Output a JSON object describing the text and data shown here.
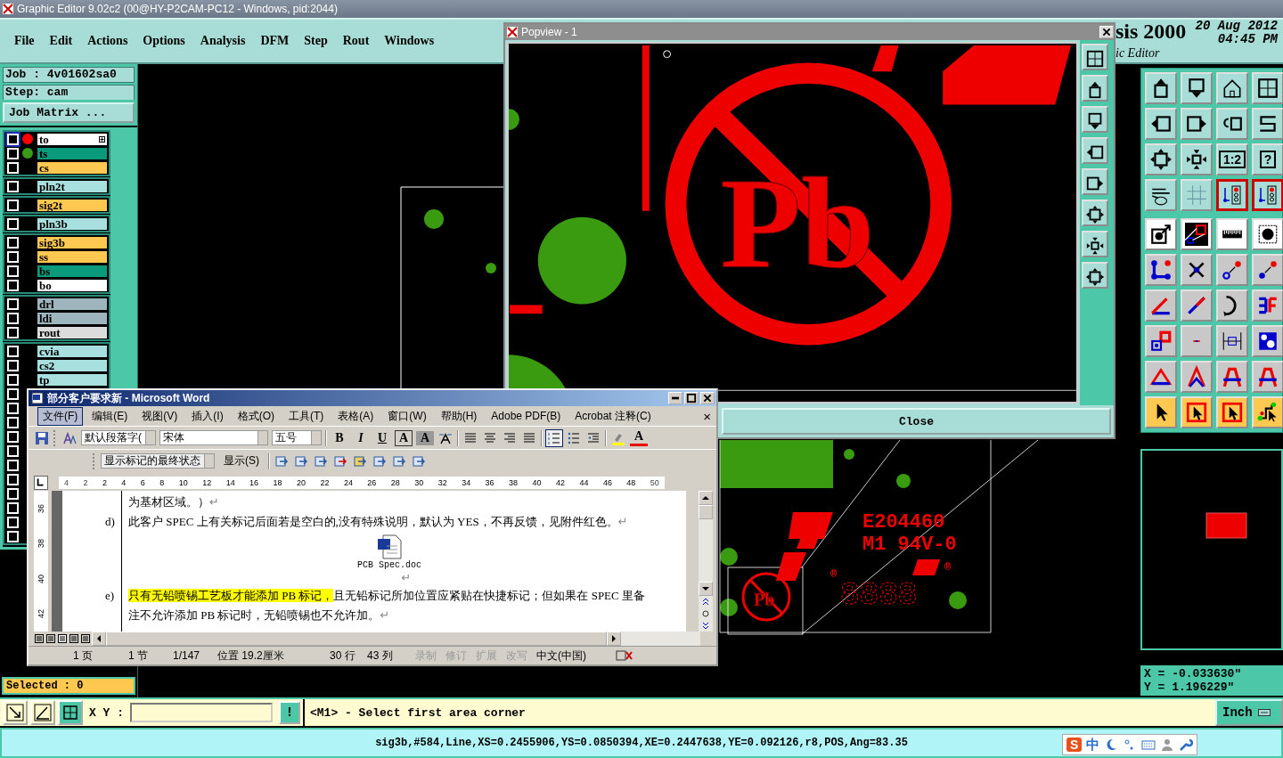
{
  "window": {
    "title": "Graphic Editor 9.02c2 (00@HY-P2CAM-PC12 - Windows, pid:2044)"
  },
  "menu": [
    {
      "label": "File"
    },
    {
      "label": "Edit"
    },
    {
      "label": "Actions"
    },
    {
      "label": "Options"
    },
    {
      "label": "Analysis"
    },
    {
      "label": "DFM"
    },
    {
      "label": "Step"
    },
    {
      "label": "Rout"
    },
    {
      "label": "Windows"
    }
  ],
  "header": {
    "product": "sis 2000",
    "date": "20 Aug 2012",
    "time": "04:45 PM",
    "subtitle": "ic Editor"
  },
  "job": {
    "job": "Job : 4v01602sa0",
    "step": "Step: cam",
    "matrix_button": "Job Matrix ..."
  },
  "layer_groups": [
    {
      "layers": [
        {
          "name": "to",
          "color": "#ffffff",
          "dot": {
            "color": "#ff0000"
          },
          "selected": true
        },
        {
          "name": "ts",
          "color": "#0a9a7c",
          "dot": {
            "color": "#3a9a1a"
          },
          "selected": false
        },
        {
          "name": "cs",
          "color": "#ffc850",
          "selected": false
        }
      ]
    },
    {
      "layers": [
        {
          "name": "pln2t",
          "color": "#a8e0e0",
          "selected": false
        }
      ]
    },
    {
      "layers": [
        {
          "name": "sig2t",
          "color": "#ffc850",
          "selected": false
        }
      ]
    },
    {
      "layers": [
        {
          "name": "pln3b",
          "color": "#a8e0e0",
          "selected": false
        }
      ]
    },
    {
      "layers": [
        {
          "name": "sig3b",
          "color": "#ffc850",
          "selected": false
        },
        {
          "name": "ss",
          "color": "#ffc850",
          "selected": false
        },
        {
          "name": "bs",
          "color": "#0a9a7c",
          "selected": false
        },
        {
          "name": "bo",
          "color": "#ffffff",
          "selected": false
        }
      ]
    },
    {
      "layers": [
        {
          "name": "drl",
          "color": "#9fb5bd",
          "selected": false
        },
        {
          "name": "ldi",
          "color": "#9fb5bd",
          "selected": false
        },
        {
          "name": "rout",
          "color": "#dcdcdc",
          "selected": false
        }
      ]
    },
    {
      "layers": [
        {
          "name": "cvia",
          "color": "#a8e0e0",
          "selected": false
        },
        {
          "name": "cs2",
          "color": "#a8e0e0",
          "selected": false
        },
        {
          "name": "tp",
          "color": "#a8e0e0",
          "selected": false
        },
        {
          "selected": false
        },
        {
          "selected": false
        },
        {
          "selected": false
        },
        {
          "selected": false
        },
        {
          "selected": false
        },
        {
          "selected": false
        },
        {
          "selected": false
        },
        {
          "selected": false
        },
        {
          "selected": false
        },
        {
          "selected": false
        },
        {
          "selected": false
        }
      ]
    }
  ],
  "selected_count": "Selected : 0",
  "canvas": {
    "labels": [
      "E204460",
      "M1 94V-0",
      "®",
      "®",
      "Pb",
      "8888"
    ]
  },
  "popview": {
    "title": "Popview - 1",
    "close_button": "Close",
    "labels": [
      "Pb"
    ]
  },
  "tools": [
    {
      "kind": "teal",
      "active": false
    },
    {
      "kind": "teal",
      "active": false
    },
    {
      "kind": "teal",
      "active": false
    },
    {
      "kind": "teal",
      "active": false
    },
    {
      "kind": "teal",
      "active": false
    },
    {
      "kind": "teal",
      "active": false
    },
    {
      "kind": "teal",
      "active": false
    },
    {
      "kind": "teal",
      "active": false
    },
    {
      "kind": "teal",
      "active": false
    },
    {
      "kind": "teal",
      "active": false
    },
    {
      "kind": "teal",
      "active": false,
      "label": "1:2"
    },
    {
      "kind": "teal",
      "active": false,
      "label": "?"
    },
    {
      "kind": "teal",
      "active": false
    },
    {
      "kind": "teal",
      "active": false
    },
    {
      "kind": "teal",
      "active": true
    },
    {
      "kind": "teal",
      "active": true
    },
    {
      "kind": "white",
      "active": false
    },
    {
      "kind": "white",
      "active": false
    },
    {
      "kind": "white",
      "active": false
    },
    {
      "kind": "white",
      "active": false
    },
    {
      "kind": "grey",
      "active": false
    },
    {
      "kind": "grey",
      "active": false
    },
    {
      "kind": "grey",
      "active": false
    },
    {
      "kind": "grey",
      "active": false
    },
    {
      "kind": "grey",
      "active": false
    },
    {
      "kind": "grey",
      "active": false
    },
    {
      "kind": "grey",
      "active": false
    },
    {
      "kind": "grey",
      "active": false
    },
    {
      "kind": "grey",
      "active": false
    },
    {
      "kind": "grey",
      "active": false
    },
    {
      "kind": "grey",
      "active": false
    },
    {
      "kind": "grey",
      "active": false
    },
    {
      "kind": "grey",
      "active": false
    },
    {
      "kind": "grey",
      "active": false
    },
    {
      "kind": "grey",
      "active": false
    },
    {
      "kind": "grey",
      "active": false
    },
    {
      "kind": "orange",
      "active": false
    },
    {
      "kind": "orange",
      "active": false
    },
    {
      "kind": "orange",
      "active": false
    },
    {
      "kind": "orange",
      "active": false
    }
  ],
  "coordinates": {
    "x": "X = -0.033630\"",
    "y": "Y = 1.196229\""
  },
  "command": {
    "xy_label": "X Y :",
    "bang_button": "!",
    "prompt": "<M1> - Select first area corner",
    "units": "Inch"
  },
  "status_bar": {
    "text": "sig3b,#584,Line,XS=0.2455906,YS=0.0850394,XE=0.2447638,YE=0.092126,r8,POS,Ang=83.35"
  },
  "ime": {
    "logo": "S",
    "mode": "中"
  },
  "word": {
    "title": "部分客户要求新 - Microsoft Word",
    "menu": [
      {
        "label": "文件(F)",
        "selected": true
      },
      {
        "label": "编辑(E)",
        "selected": false
      },
      {
        "label": "视图(V)",
        "selected": false
      },
      {
        "label": "插入(I)",
        "selected": false
      },
      {
        "label": "格式(O)",
        "selected": false
      },
      {
        "label": "工具(T)",
        "selected": false
      },
      {
        "label": "表格(A)",
        "selected": false
      },
      {
        "label": "窗口(W)",
        "selected": false
      },
      {
        "label": "帮助(H)",
        "selected": false
      },
      {
        "label": "Adobe PDF(B)",
        "selected": false
      },
      {
        "label": "Acrobat 注释(C)",
        "selected": false
      }
    ],
    "menu_close": "×",
    "format_toolbar": {
      "style": "默认段落字(",
      "font": "宋体",
      "size": "五号",
      "buttons": [
        "B",
        "I",
        "U",
        "A",
        "A"
      ],
      "font_color": "A"
    },
    "review_toolbar": {
      "view": "显示标记的最终状态",
      "show": "显示(S)"
    },
    "ruler": [
      "4",
      "2",
      "2",
      "4",
      "6",
      "8",
      "10",
      "12",
      "14",
      "16",
      "18",
      "20",
      "22",
      "24",
      "26",
      "28",
      "30",
      "32",
      "34",
      "36",
      "38",
      "40",
      "42",
      "44",
      "46",
      "48",
      "50"
    ],
    "vruler": [
      "36",
      "38",
      "40",
      "42"
    ],
    "paragraphs": [
      {
        "kind": "text",
        "segments": [
          {
            "text": "为基材区域。）",
            "highlighted": false
          }
        ],
        "end": "↵"
      },
      {
        "kind": "item",
        "marker": "d)",
        "segments": [
          {
            "text": "此客户 SPEC 上有关标记后面若是空白的,没有特殊说明，默认为 YES，不再反馈，见附件红色。",
            "highlighted": false
          }
        ],
        "end": "↵"
      },
      {
        "kind": "file",
        "caption": "PCB Spec.doc"
      },
      {
        "kind": "blank",
        "end": "↵"
      },
      {
        "kind": "item",
        "marker": "e)",
        "segments": [
          {
            "text": "只有无铅喷锡工艺板才能添加 PB 标记，",
            "highlighted": true
          },
          {
            "text": "且无铅标记所加位置应紧贴在快捷标记；但如果在 SPEC 里备注不允许添加 PB 标记时，无铅喷锡也不允许加。",
            "highlighted": false
          }
        ],
        "end": "↵"
      }
    ],
    "status": [
      {
        "text": "1 页",
        "disabled": false
      },
      {
        "text": "1 节",
        "disabled": false
      },
      {
        "text": "1/147",
        "disabled": false
      },
      {
        "text": "位置 19.2厘米",
        "disabled": false
      },
      {
        "text": "30 行",
        "disabled": false
      },
      {
        "text": "43 列",
        "disabled": false
      },
      {
        "text": "录制",
        "disabled": true
      },
      {
        "text": "修订",
        "disabled": true
      },
      {
        "text": "扩展",
        "disabled": true
      },
      {
        "text": "改写",
        "disabled": true
      },
      {
        "text": "中文(中国)",
        "disabled": false
      }
    ]
  }
}
